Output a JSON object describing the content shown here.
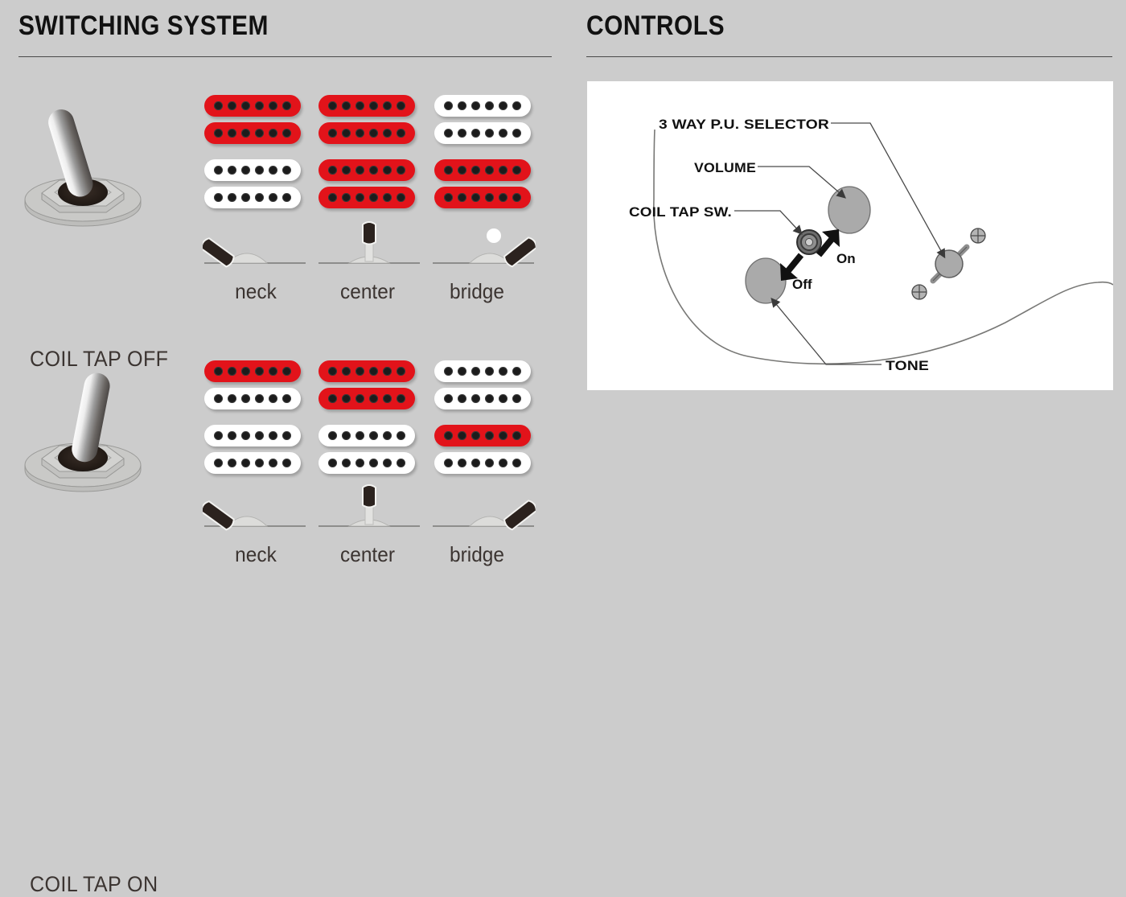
{
  "colors": {
    "background": "#cccccc",
    "panel": "#ffffff",
    "coil_active": "#e2131a",
    "coil_inactive": "#ffffff",
    "pole_piece": "#1c1c1c",
    "text": "#3b3431",
    "heading": "#111111",
    "knob_fill": "#a8a8a8"
  },
  "sections": {
    "switching": {
      "title": "SWITCHING SYSTEM"
    },
    "controls": {
      "title": "CONTROLS"
    }
  },
  "switching_system": {
    "rows": [
      {
        "mode_label": "COIL TAP OFF",
        "toggle_state": "off",
        "toggle_lever_direction": "left",
        "positions": [
          {
            "caption": "neck",
            "switch_position": "neck",
            "lever_direction": "left",
            "indicator_dot": false,
            "pickups": [
              {
                "name": "neck-humbucker",
                "coils": [
                  "active",
                  "active"
                ]
              },
              {
                "name": "bridge-humbucker",
                "coils": [
                  "inactive",
                  "inactive"
                ]
              }
            ]
          },
          {
            "caption": "center",
            "switch_position": "center",
            "lever_direction": "up",
            "indicator_dot": false,
            "pickups": [
              {
                "name": "neck-humbucker",
                "coils": [
                  "active",
                  "active"
                ]
              },
              {
                "name": "bridge-humbucker",
                "coils": [
                  "active",
                  "active"
                ]
              }
            ]
          },
          {
            "caption": "bridge",
            "switch_position": "bridge",
            "lever_direction": "right",
            "indicator_dot": true,
            "pickups": [
              {
                "name": "neck-humbucker",
                "coils": [
                  "inactive",
                  "inactive"
                ]
              },
              {
                "name": "bridge-humbucker",
                "coils": [
                  "active",
                  "active"
                ]
              }
            ]
          }
        ]
      },
      {
        "mode_label": "COIL TAP ON",
        "toggle_state": "on",
        "toggle_lever_direction": "right",
        "positions": [
          {
            "caption": "neck",
            "switch_position": "neck",
            "lever_direction": "left",
            "indicator_dot": false,
            "pickups": [
              {
                "name": "neck-humbucker",
                "coils": [
                  "active",
                  "inactive"
                ]
              },
              {
                "name": "bridge-humbucker",
                "coils": [
                  "inactive",
                  "inactive"
                ]
              }
            ]
          },
          {
            "caption": "center",
            "switch_position": "center",
            "lever_direction": "up",
            "indicator_dot": false,
            "pickups": [
              {
                "name": "neck-humbucker",
                "coils": [
                  "active",
                  "inactive"
                ]
              },
              {
                "name": "bridge-humbucker",
                "coils": [
                  "active",
                  "inactive"
                ]
              }
            ]
          },
          {
            "caption": "bridge",
            "switch_position": "bridge",
            "lever_direction": "right",
            "indicator_dot": false,
            "pickups": [
              {
                "name": "neck-humbucker",
                "coils": [
                  "inactive",
                  "inactive"
                ]
              },
              {
                "name": "bridge-humbucker",
                "coils": [
                  "active",
                  "inactive"
                ]
              }
            ]
          }
        ]
      }
    ],
    "poles_per_coil": 6
  },
  "controls_diagram": {
    "labels": {
      "selector": "3 WAY P.U. SELECTOR",
      "volume": "VOLUME",
      "coil_tap_sw": "COIL TAP SW.",
      "tone": "TONE",
      "switch_on": "On",
      "switch_off": "Off"
    },
    "components": [
      {
        "name": "volume-knob",
        "type": "rotary-knob"
      },
      {
        "name": "tone-knob",
        "type": "rotary-knob"
      },
      {
        "name": "coil-tap-switch",
        "type": "mini-toggle"
      },
      {
        "name": "three-way-selector",
        "type": "blade-switch"
      }
    ]
  }
}
